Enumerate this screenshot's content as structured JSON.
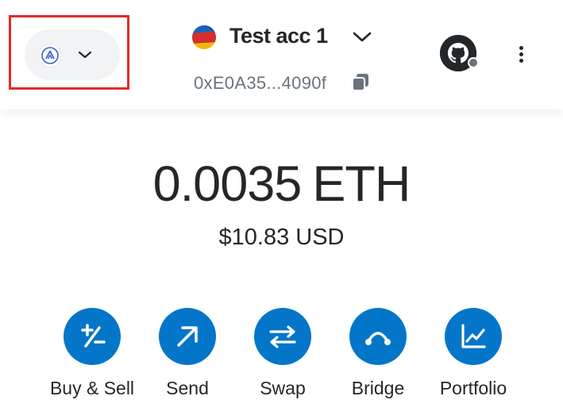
{
  "header": {
    "network": {
      "icon": "aurora-network-icon",
      "chevron_icon": "chevron-down-icon"
    },
    "account": {
      "name": "Test acc 1",
      "address": "0xE0A35...4090f",
      "copy_icon": "copy-icon"
    },
    "profile_icon": "github-icon",
    "menu_icon": "kebab-menu-icon"
  },
  "balance": {
    "amount": "0.0035",
    "unit": "ETH",
    "fiat": "$10.83 USD"
  },
  "actions": [
    {
      "label": "Buy & Sell",
      "icon": "buy-sell-icon"
    },
    {
      "label": "Send",
      "icon": "send-arrow-icon"
    },
    {
      "label": "Swap",
      "icon": "swap-icon"
    },
    {
      "label": "Bridge",
      "icon": "bridge-icon"
    },
    {
      "label": "Portfolio",
      "icon": "portfolio-chart-icon"
    }
  ],
  "colors": {
    "accent": "#0376c9",
    "highlight_border": "#e12b2b",
    "text_primary": "#24272a",
    "text_muted": "#6a737d"
  }
}
